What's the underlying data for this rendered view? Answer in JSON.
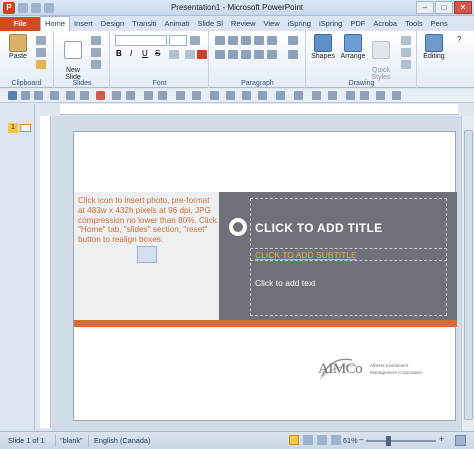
{
  "window": {
    "title": "Presentation1 - Microsoft PowerPoint",
    "app_letter": "P",
    "controls": [
      "–",
      "□",
      "✕"
    ]
  },
  "tabs": [
    {
      "label": "File",
      "active": false
    },
    {
      "label": "Home",
      "active": true
    },
    {
      "label": "Insert",
      "active": false
    },
    {
      "label": "Design",
      "active": false
    },
    {
      "label": "Transiti",
      "active": false
    },
    {
      "label": "Animati",
      "active": false
    },
    {
      "label": "Slide Sl",
      "active": false
    },
    {
      "label": "Review",
      "active": false
    },
    {
      "label": "View",
      "active": false
    },
    {
      "label": "iSpring",
      "active": false
    },
    {
      "label": "iSpring",
      "active": false
    },
    {
      "label": "PDF",
      "active": false
    },
    {
      "label": "Acroba",
      "active": false
    },
    {
      "label": "Tools",
      "active": false
    },
    {
      "label": "Pens",
      "active": false
    }
  ],
  "ribbon": {
    "clipboard": {
      "label": "Clipboard",
      "paste": "Paste"
    },
    "slides": {
      "label": "Slides",
      "new_slide": "New\nSlide"
    },
    "font": {
      "label": "Font"
    },
    "paragraph": {
      "label": "Paragraph"
    },
    "drawing": {
      "label": "Drawing",
      "shapes": "Shapes",
      "arrange": "Arrange",
      "quick_styles": "Quick\nStyles"
    },
    "editing": {
      "label": "Editing"
    }
  },
  "slides_pane": {
    "slide_number": "1"
  },
  "slide": {
    "photo_instructions": "Click icon to insert photo, pre-format at 483w x 432h pixels at 96 dpi, JPG compression no lower than 80%. Click \"Home\" tab, \"slides\" section, \"reset\" button to realign boxes.",
    "title": "CLICK TO ADD TITLE",
    "subtitle": "CLICK TO ADD SUBTITLE",
    "body": "Click to add text",
    "logo": {
      "name": "AIMCo",
      "tag_line1": "Alberta Investment",
      "tag_line2": "Management Corporation"
    }
  },
  "status_bar": {
    "slide_info": "Slide 1 of 1",
    "theme": "\"blank\"",
    "language": "English (Canada)",
    "zoom": "61%",
    "zoom_level_percent": 61
  },
  "colors": {
    "file_tab": "#d04a22",
    "accent_orange": "#d9693a",
    "title_grey": "#6e7177",
    "subtitle_gold": "#e6b34c",
    "photo_text": "#d0703a"
  }
}
